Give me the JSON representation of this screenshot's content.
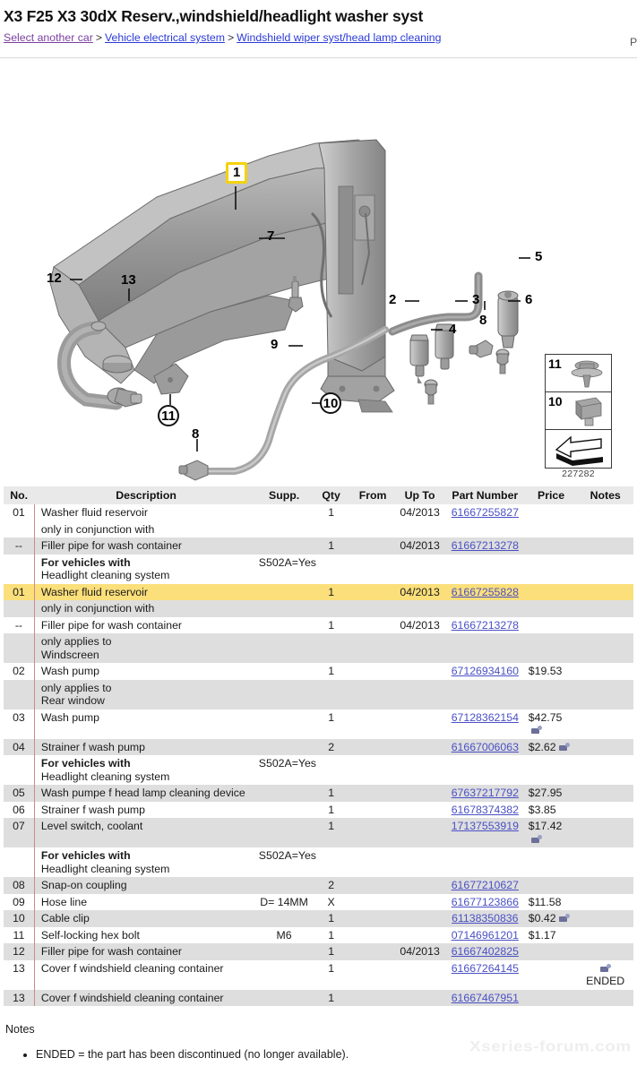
{
  "header": {
    "title": "X3 F25 X3 30dX Reserv.,windshield/headlight washer syst",
    "breadcrumb": {
      "item1": "Select another car",
      "sep1": ">",
      "item2": "Vehicle electrical system",
      "sep2": ">",
      "item3": "Windshield wiper syst/head lamp cleaning"
    },
    "right_clipped": "P",
    "link_color": "#2b3ad6",
    "visited_color": "#7a3fa0"
  },
  "diagram": {
    "id_label": "227282",
    "highlight_color": "#f5d20c",
    "callouts": [
      {
        "label": "1",
        "style": "boxed"
      },
      {
        "label": "2",
        "style": "plain"
      },
      {
        "label": "3",
        "style": "plain"
      },
      {
        "label": "4",
        "style": "plain"
      },
      {
        "label": "5",
        "style": "plain"
      },
      {
        "label": "6",
        "style": "plain"
      },
      {
        "label": "7",
        "style": "plain"
      },
      {
        "label": "8",
        "style": "plain"
      },
      {
        "label": "8",
        "style": "plain"
      },
      {
        "label": "9",
        "style": "plain"
      },
      {
        "label": "10",
        "style": "circled"
      },
      {
        "label": "11",
        "style": "circled"
      },
      {
        "label": "12",
        "style": "plain"
      },
      {
        "label": "13",
        "style": "plain"
      }
    ],
    "thumbs": [
      {
        "num": "11"
      },
      {
        "num": "10"
      }
    ]
  },
  "table": {
    "columns": [
      "No.",
      "Description",
      "Supp.",
      "Qty",
      "From",
      "Up To",
      "Part Number",
      "Price",
      "Notes"
    ],
    "rows": [
      {
        "style": "white",
        "no": "01",
        "desc": "Washer fluid reservoir",
        "bold": false,
        "supp": "",
        "qty": "1",
        "from": "",
        "upto": "04/2013",
        "part": "61667255827",
        "price": "",
        "cart": false,
        "notes": ""
      },
      {
        "style": "white",
        "no": "",
        "desc": "only in conjunction with",
        "bold": false,
        "supp": "",
        "qty": "",
        "from": "",
        "upto": "",
        "part": "",
        "price": "",
        "cart": false,
        "notes": ""
      },
      {
        "style": "grey",
        "no": "--",
        "desc": "Filler pipe for wash container",
        "bold": false,
        "supp": "",
        "qty": "1",
        "from": "",
        "upto": "04/2013",
        "part": "61667213278",
        "price": "",
        "cart": false,
        "notes": ""
      },
      {
        "style": "white",
        "no": "",
        "desc": "For vehicles with",
        "desc2": "Headlight cleaning system",
        "bold": true,
        "supp": "S502A=Yes",
        "qty": "",
        "from": "",
        "upto": "",
        "part": "",
        "price": "",
        "cart": false,
        "notes": ""
      },
      {
        "style": "hl",
        "no": "01",
        "desc": "Washer fluid reservoir",
        "bold": false,
        "supp": "",
        "qty": "1",
        "from": "",
        "upto": "04/2013",
        "part": "61667255828",
        "price": "",
        "cart": false,
        "notes": ""
      },
      {
        "style": "grey",
        "no": "",
        "desc": "only in conjunction with",
        "bold": false,
        "supp": "",
        "qty": "",
        "from": "",
        "upto": "",
        "part": "",
        "price": "",
        "cart": false,
        "notes": ""
      },
      {
        "style": "white",
        "no": "--",
        "desc": "Filler pipe for wash container",
        "bold": false,
        "supp": "",
        "qty": "1",
        "from": "",
        "upto": "04/2013",
        "part": "61667213278",
        "price": "",
        "cart": false,
        "notes": ""
      },
      {
        "style": "grey",
        "no": "",
        "desc": "only applies to",
        "desc2": "Windscreen",
        "bold": false,
        "supp": "",
        "qty": "",
        "from": "",
        "upto": "",
        "part": "",
        "price": "",
        "cart": false,
        "notes": ""
      },
      {
        "style": "white",
        "no": "02",
        "desc": "Wash pump",
        "bold": false,
        "supp": "",
        "qty": "1",
        "from": "",
        "upto": "",
        "part": "67126934160",
        "price": "$19.53",
        "cart": false,
        "notes": ""
      },
      {
        "style": "grey",
        "no": "",
        "desc": "only applies to",
        "desc2": "Rear window",
        "bold": false,
        "supp": "",
        "qty": "",
        "from": "",
        "upto": "",
        "part": "",
        "price": "",
        "cart": false,
        "notes": ""
      },
      {
        "style": "white",
        "no": "03",
        "desc": "Wash pump",
        "bold": false,
        "supp": "",
        "qty": "1",
        "from": "",
        "upto": "",
        "part": "67128362154",
        "price": "$42.75",
        "cart": true,
        "notes": ""
      },
      {
        "style": "grey",
        "no": "04",
        "desc": "Strainer f wash pump",
        "bold": false,
        "supp": "",
        "qty": "2",
        "from": "",
        "upto": "",
        "part": "61667006063",
        "price": "$2.62",
        "cart": true,
        "notes": ""
      },
      {
        "style": "white",
        "no": "",
        "desc": "For vehicles with",
        "desc2": "Headlight cleaning system",
        "bold": true,
        "supp": "S502A=Yes",
        "qty": "",
        "from": "",
        "upto": "",
        "part": "",
        "price": "",
        "cart": false,
        "notes": ""
      },
      {
        "style": "grey",
        "no": "05",
        "desc": "Wash pumpe f head lamp cleaning device",
        "bold": false,
        "supp": "",
        "qty": "1",
        "from": "",
        "upto": "",
        "part": "67637217792",
        "price": "$27.95",
        "cart": false,
        "notes": ""
      },
      {
        "style": "white",
        "no": "06",
        "desc": "Strainer f wash pump",
        "bold": false,
        "supp": "",
        "qty": "1",
        "from": "",
        "upto": "",
        "part": "61678374382",
        "price": "$3.85",
        "cart": false,
        "notes": ""
      },
      {
        "style": "grey",
        "no": "07",
        "desc": "Level switch, coolant",
        "bold": false,
        "supp": "",
        "qty": "1",
        "from": "",
        "upto": "",
        "part": "17137553919",
        "price": "$17.42",
        "cart": true,
        "notes": ""
      },
      {
        "style": "white",
        "no": "",
        "desc": "For vehicles with",
        "desc2": "Headlight cleaning system",
        "bold": true,
        "supp": "S502A=Yes",
        "qty": "",
        "from": "",
        "upto": "",
        "part": "",
        "price": "",
        "cart": false,
        "notes": ""
      },
      {
        "style": "grey",
        "no": "08",
        "desc": "Snap-on coupling",
        "bold": false,
        "supp": "",
        "qty": "2",
        "from": "",
        "upto": "",
        "part": "61677210627",
        "price": "",
        "cart": false,
        "notes": ""
      },
      {
        "style": "white",
        "no": "09",
        "desc": "Hose line",
        "bold": false,
        "supp": "D= 14MM",
        "qty": "X",
        "from": "",
        "upto": "",
        "part": "61677123866",
        "price": "$11.58",
        "cart": false,
        "notes": ""
      },
      {
        "style": "grey",
        "no": "10",
        "desc": "Cable clip",
        "bold": false,
        "supp": "",
        "qty": "1",
        "from": "",
        "upto": "",
        "part": "61138350836",
        "price": "$0.42",
        "cart": true,
        "notes": ""
      },
      {
        "style": "white",
        "no": "11",
        "desc": "Self-locking hex bolt",
        "bold": false,
        "supp": "M6",
        "qty": "1",
        "from": "",
        "upto": "",
        "part": "07146961201",
        "price": "$1.17",
        "cart": false,
        "notes": ""
      },
      {
        "style": "grey",
        "no": "12",
        "desc": "Filler pipe for wash container",
        "bold": false,
        "supp": "",
        "qty": "1",
        "from": "",
        "upto": "04/2013",
        "part": "61667402825",
        "price": "",
        "cart": false,
        "notes": ""
      },
      {
        "style": "white",
        "no": "13",
        "desc": "Cover f windshield cleaning container",
        "bold": false,
        "supp": "",
        "qty": "1",
        "from": "",
        "upto": "",
        "part": "61667264145",
        "price": "",
        "cart": true,
        "notes": "ENDED"
      },
      {
        "style": "grey",
        "no": "13",
        "desc": "Cover f windshield cleaning container",
        "bold": false,
        "supp": "",
        "qty": "1",
        "from": "",
        "upto": "",
        "part": "61667467951",
        "price": "",
        "cart": false,
        "notes": ""
      }
    ]
  },
  "notes": {
    "heading": "Notes",
    "items": [
      "ENDED = the part has been discontinued (no longer available)."
    ]
  },
  "watermark": "Xseries-forum.com"
}
